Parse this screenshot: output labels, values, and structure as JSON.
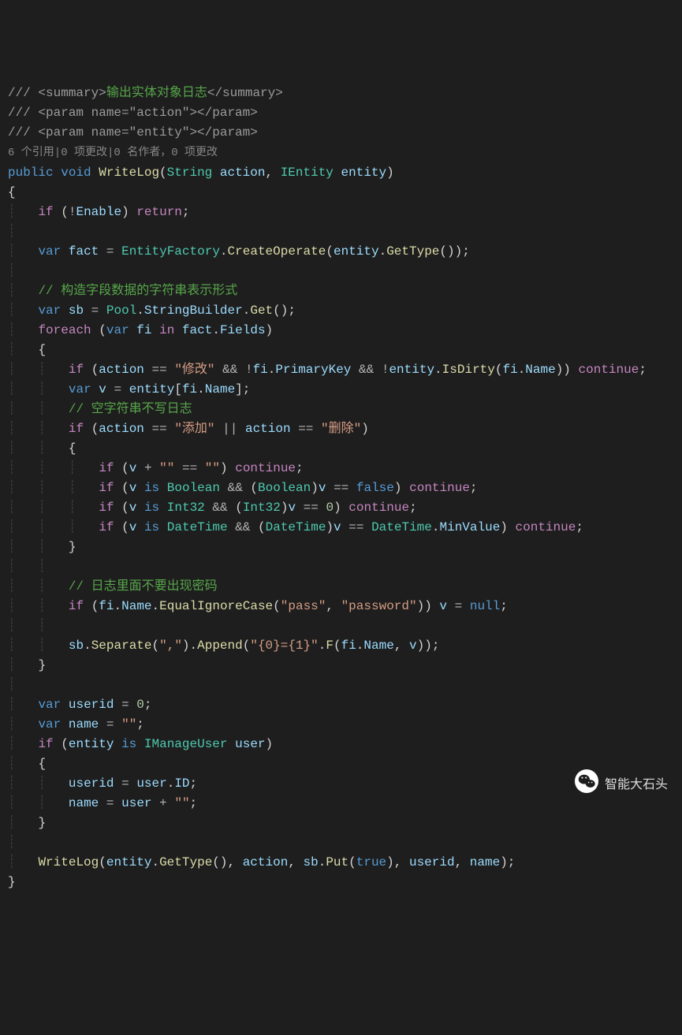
{
  "doc": {
    "summary_open": "/// <summary>",
    "summary_text": "输出实体对象日志",
    "summary_close": "</summary>",
    "param1": "/// <param name=\"action\"></param>",
    "param2": "/// <param name=\"entity\"></param>"
  },
  "codelens": "6 个引用|0 项更改|0 名作者，0 项更改",
  "sig": {
    "public": "public",
    "void": "void",
    "method": "WriteLog",
    "p1t": "String",
    "p1n": "action",
    "p2t": "IEntity",
    "p2n": "entity"
  },
  "l": {
    "if": "if",
    "return": "return",
    "var": "var",
    "foreach": "foreach",
    "in": "in",
    "continue": "continue",
    "is": "is",
    "null": "null",
    "false": "false",
    "true": "true"
  },
  "v": {
    "Enable": "Enable",
    "fact": "fact",
    "EntityFactory": "EntityFactory",
    "CreateOperate": "CreateOperate",
    "entity": "entity",
    "GetType": "GetType",
    "sb": "sb",
    "Pool": "Pool",
    "StringBuilder": "StringBuilder",
    "Get": "Get",
    "fi": "fi",
    "Fields": "Fields",
    "action": "action",
    "PrimaryKey": "PrimaryKey",
    "IsDirty": "IsDirty",
    "Name": "Name",
    "v": "v",
    "Boolean": "Boolean",
    "Int32": "Int32",
    "DateTime": "DateTime",
    "MinValue": "MinValue",
    "EqualIgnoreCase": "EqualIgnoreCase",
    "Separate": "Separate",
    "Append": "Append",
    "F": "F",
    "userid": "userid",
    "name": "name",
    "IManageUser": "IManageUser",
    "user": "user",
    "ID": "ID",
    "WriteLog": "WriteLog",
    "Put": "Put"
  },
  "s": {
    "modify": "\"修改\"",
    "add": "\"添加\"",
    "delete": "\"删除\"",
    "empty": "\"\"",
    "pass": "\"pass\"",
    "password": "\"password\"",
    "comma": "\",\"",
    "fmt": "\"{0}={1}\""
  },
  "n": {
    "zero": "0"
  },
  "cmt": {
    "c1": "// 构造字段数据的字符串表示形式",
    "c2": "// 空字符串不写日志",
    "c3": "// 日志里面不要出现密码"
  },
  "watermark": "智能大石头"
}
